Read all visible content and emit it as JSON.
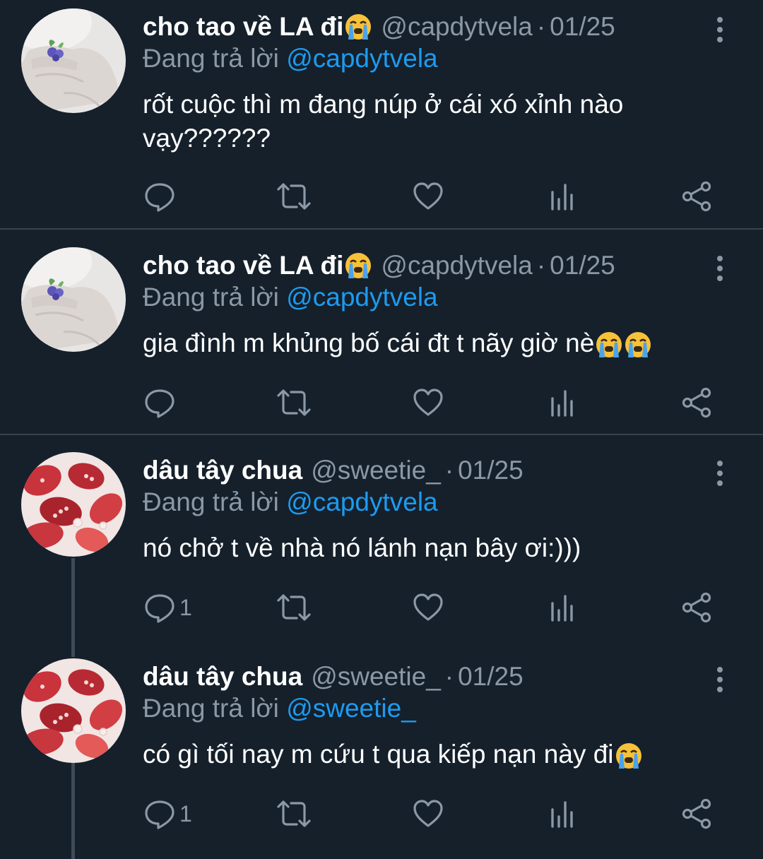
{
  "tweets": [
    {
      "name": "cho tao về LA đi",
      "handle": "@capdytvela",
      "separator": "·",
      "date": "01/25",
      "reply_prefix": "Đang trả lời",
      "reply_to": "@capdytvela",
      "text": "rốt cuộc thì m đang núp ở cái xó xỉnh nào vạy??????",
      "reply_count": "",
      "avatar": "hand-with-ring"
    },
    {
      "name": "cho tao về LA đi",
      "handle": "@capdytvela",
      "separator": "·",
      "date": "01/25",
      "reply_prefix": "Đang trả lời",
      "reply_to": "@capdytvela",
      "text": "gia đình m khủng bố cái đt t nãy giờ nè",
      "reply_count": "",
      "avatar": "hand-with-ring"
    },
    {
      "name": "dâu tây chua",
      "handle": "@sweetie_",
      "separator": "·",
      "date": "01/25",
      "reply_prefix": "Đang trả lời",
      "reply_to": "@capdytvela",
      "text": "nó chở t về nhà nó lánh nạn bây ơi:)))",
      "reply_count": "1",
      "avatar": "strawberries-in-milk"
    },
    {
      "name": "dâu tây chua",
      "handle": "@sweetie_",
      "separator": "·",
      "date": "01/25",
      "reply_prefix": "Đang trả lời",
      "reply_to": "@sweetie_",
      "text": "có gì tối nay m cứu t qua kiếp nạn này đi",
      "reply_count": "1",
      "avatar": "strawberries-in-milk"
    }
  ],
  "icons": {
    "reply": "reply-icon",
    "retweet": "retweet-icon",
    "like": "heart-icon",
    "analytics": "analytics-icon",
    "share": "share-icon",
    "more": "more-vertical-icon",
    "emoji": "loudly-crying-face-icon"
  },
  "colors": {
    "background": "#15202b",
    "text": "#ffffff",
    "secondary": "#8b98a5",
    "link": "#1d9bf0",
    "divider": "#38444d"
  }
}
